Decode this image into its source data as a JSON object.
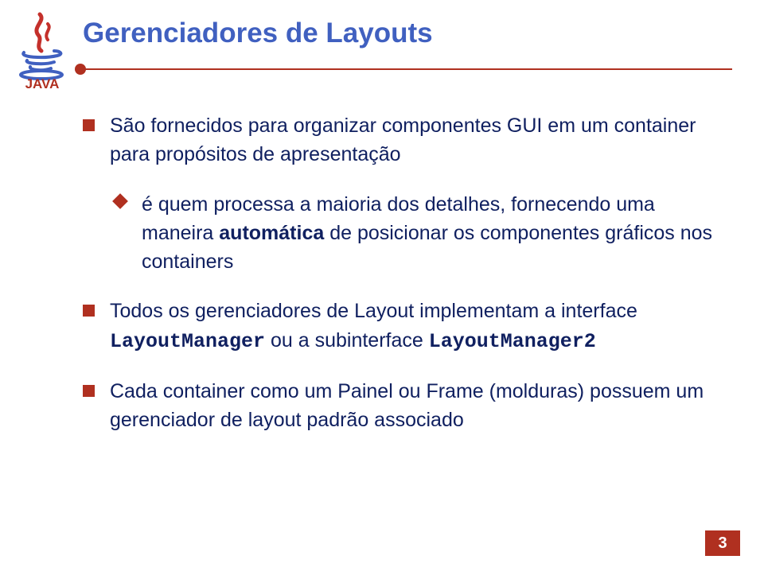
{
  "title": "Gerenciadores de Layouts",
  "bullets": {
    "b1_a": "São fornecidos para organizar componentes GUI em um container para propósitos de apresentação",
    "b1_1_a": "é quem processa a maioria dos detalhes, fornecendo uma maneira ",
    "b1_1_bold": "automática",
    "b1_1_c": " de posicionar os componentes gráficos nos containers",
    "b2_a": "Todos os gerenciadores de Layout implementam a interface ",
    "b2_code1": "LayoutManager",
    "b2_b": " ou a subinterface ",
    "b2_code2": "LayoutManager2",
    "b3_a": "Cada container como um Painel ou Frame (molduras) possuem um gerenciador de layout padrão associado"
  },
  "page_number": "3"
}
